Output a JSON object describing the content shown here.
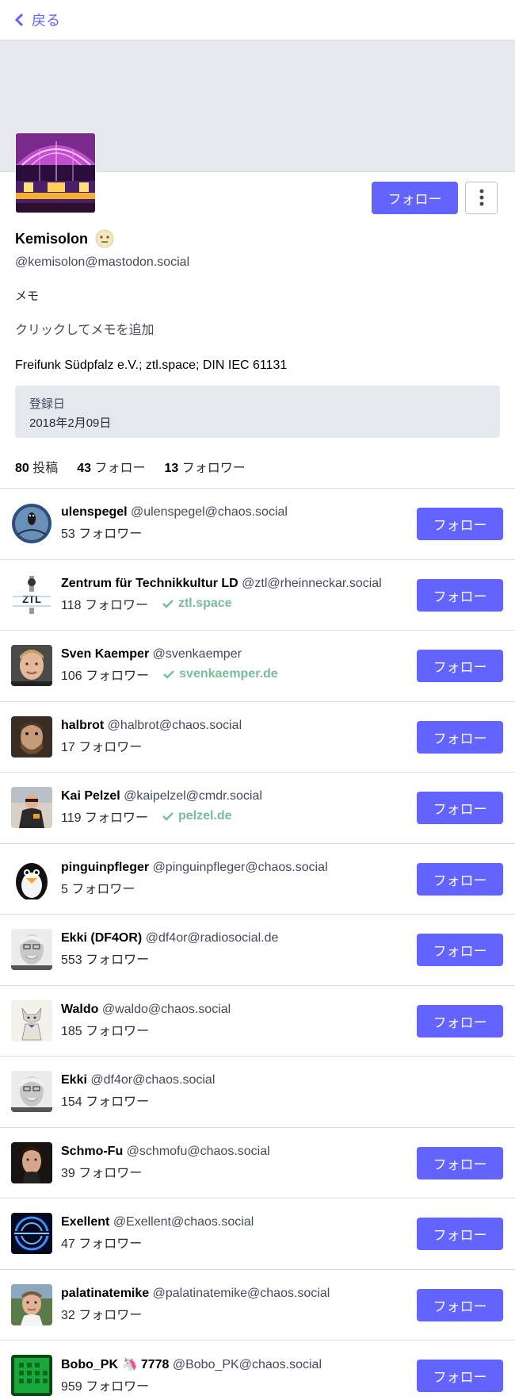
{
  "nav": {
    "back_label": "戻る"
  },
  "profile": {
    "display_name": "Kemisolon",
    "handle": "@kemisolon@mastodon.social",
    "follow_label": "フォロー",
    "memo_label": "メモ",
    "memo_placeholder": "クリックしてメモを追加",
    "bio": "Freifunk Südpfalz e.V.; ztl.space; DIN IEC 61131",
    "joined_label": "登録日",
    "joined_date": "2018年2月09日",
    "stats": {
      "posts_count": "80",
      "posts_label": "投稿",
      "following_count": "43",
      "following_label": "フォロー",
      "followers_count": "13",
      "followers_label": "フォロワー"
    }
  },
  "accounts": [
    {
      "display_name": "ulenspegel",
      "handle": "@ulenspegel@chaos.social",
      "followers": "53 フォロワー",
      "verified": "",
      "follow_label": "フォロー"
    },
    {
      "display_name": "Zentrum für Technikkultur LD",
      "handle": "@ztl@rheinneckar.social",
      "followers": "118 フォロワー",
      "verified": "ztl.space",
      "follow_label": "フォロー"
    },
    {
      "display_name": "Sven Kaemper",
      "handle": "@svenkaemper",
      "followers": "106 フォロワー",
      "verified": "svenkaemper.de",
      "follow_label": "フォロー"
    },
    {
      "display_name": "halbrot",
      "handle": "@halbrot@chaos.social",
      "followers": "17 フォロワー",
      "verified": "",
      "follow_label": "フォロー"
    },
    {
      "display_name": "Kai Pelzel",
      "handle": "@kaipelzel@cmdr.social",
      "followers": "119 フォロワー",
      "verified": "pelzel.de",
      "follow_label": "フォロー"
    },
    {
      "display_name": "pinguinpfleger",
      "handle": "@pinguinpfleger@chaos.social",
      "followers": "5 フォロワー",
      "verified": "",
      "follow_label": "フォロー"
    },
    {
      "display_name": "Ekki (DF4OR)",
      "handle": "@df4or@radiosocial.de",
      "followers": "553 フォロワー",
      "verified": "",
      "follow_label": "フォロー"
    },
    {
      "display_name": "Waldo",
      "handle": "@waldo@chaos.social",
      "followers": "185 フォロワー",
      "verified": "",
      "follow_label": "フォロー"
    },
    {
      "display_name": "Ekki",
      "handle": "@df4or@chaos.social",
      "followers": "154 フォロワー",
      "verified": "",
      "follow_label": ""
    },
    {
      "display_name": "Schmo-Fu",
      "handle": "@schmofu@chaos.social",
      "followers": "39 フォロワー",
      "verified": "",
      "follow_label": "フォロー"
    },
    {
      "display_name": "Exellent",
      "handle": "@Exellent@chaos.social",
      "followers": "47 フォロワー",
      "verified": "",
      "follow_label": "フォロー"
    },
    {
      "display_name": "palatinatemike",
      "handle": "@palatinatemike@chaos.social",
      "followers": "32 フォロワー",
      "verified": "",
      "follow_label": "フォロー"
    },
    {
      "display_name": "Bobo_PK 🦄 7778",
      "handle": "@Bobo_PK@chaos.social",
      "followers": "959 フォロワー",
      "verified": "",
      "follow_label": "フォロー"
    }
  ],
  "colors": {
    "accent": "#6364ff",
    "verified": "#79bd9a",
    "banner": "#e5e8ed"
  }
}
